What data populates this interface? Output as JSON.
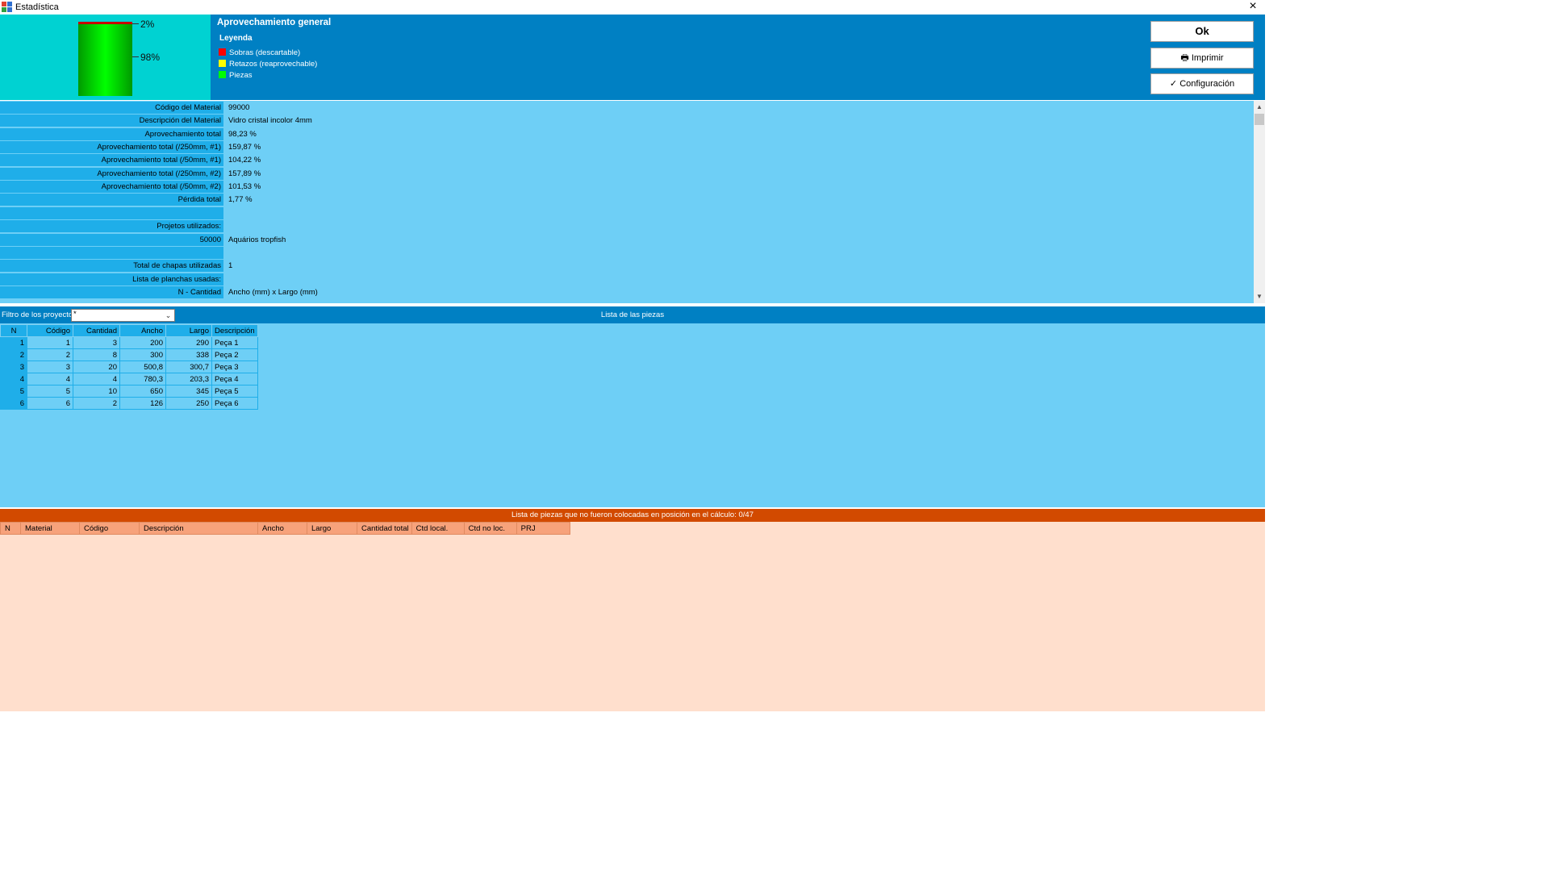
{
  "window": {
    "title": "Estadística",
    "close_icon": "×"
  },
  "chart_data": {
    "type": "bar",
    "series": [
      {
        "name": "Sobras (descartable)",
        "value": 2,
        "color": "#e00000"
      },
      {
        "name": "Piezas",
        "value": 98,
        "color": "#00e000"
      }
    ],
    "labels": [
      "2%",
      "98%"
    ]
  },
  "header": {
    "title": "Aprovechamiento general",
    "legend_title": "Leyenda",
    "legend": [
      {
        "label": "Sobras (descartable)",
        "color": "#ff0000"
      },
      {
        "label": "Retazos (reaprovechable)",
        "color": "#ffff00"
      },
      {
        "label": "Piezas",
        "color": "#00ff00"
      }
    ],
    "buttons": {
      "ok": "Ok",
      "print": "Imprimir",
      "print_icon": "🖶",
      "config": "Configuración",
      "config_icon": "✓"
    }
  },
  "stats": [
    {
      "label": "Código del Material",
      "value": "99000"
    },
    {
      "label": "Descripción del Material",
      "value": "Vidro cristal incolor 4mm"
    },
    {
      "label": "Aprovechamiento total",
      "value": "98,23 %"
    },
    {
      "label": "Aprovechamiento total (/250mm, #1)",
      "value": "159,87 %"
    },
    {
      "label": "Aprovechamiento total (/50mm, #1)",
      "value": "104,22 %"
    },
    {
      "label": "Aprovechamiento total (/250mm, #2)",
      "value": "157,89 %"
    },
    {
      "label": "Aprovechamiento total (/50mm, #2)",
      "value": "101,53 %"
    },
    {
      "label": "Pérdida total",
      "value": "1,77 %"
    },
    {
      "label": "",
      "value": ""
    },
    {
      "label": "Projetos utilizados:",
      "value": ""
    },
    {
      "label": "50000",
      "value": "Aquários tropfish"
    },
    {
      "label": "",
      "value": ""
    },
    {
      "label": "Total de chapas utilizadas",
      "value": "1"
    },
    {
      "label": "Lista de planchas usadas:",
      "value": ""
    },
    {
      "label": "N - Cantidad",
      "value": "Ancho (mm) x Largo (mm)"
    }
  ],
  "filter": {
    "label": "Filtro de los proyectos",
    "value": "*"
  },
  "pieces": {
    "title": "Lista de las piezas",
    "columns": [
      "N",
      "Código",
      "Cantidad",
      "Ancho",
      "Largo",
      "Descripción"
    ],
    "rows": [
      [
        "1",
        "1",
        "3",
        "200",
        "290",
        "Peça 1"
      ],
      [
        "2",
        "2",
        "8",
        "300",
        "338",
        "Peça 2"
      ],
      [
        "3",
        "3",
        "20",
        "500,8",
        "300,7",
        "Peça 3"
      ],
      [
        "4",
        "4",
        "4",
        "780,3",
        "203,3",
        "Peça 4"
      ],
      [
        "5",
        "5",
        "10",
        "650",
        "345",
        "Peça 5"
      ],
      [
        "6",
        "6",
        "2",
        "126",
        "250",
        "Peça 6"
      ]
    ]
  },
  "unplaced": {
    "title": "Lista de piezas que no fueron colocadas en posición en el cálculo: 0/47",
    "columns": [
      "N",
      "Material",
      "Código",
      "Descripción",
      "Ancho",
      "Largo",
      "Cantidad total",
      "Ctd local.",
      "Ctd no loc.",
      "PRJ"
    ]
  }
}
